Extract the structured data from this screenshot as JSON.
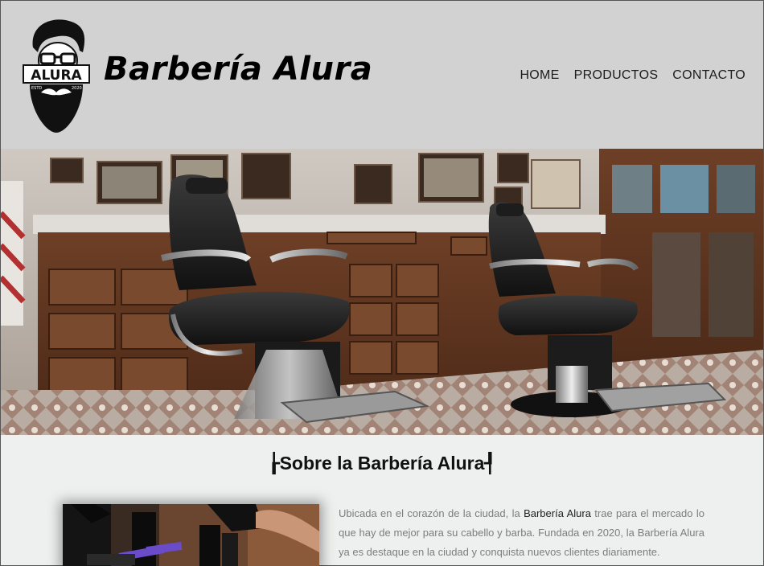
{
  "header": {
    "title": "Barbería Alura",
    "logo": {
      "name": "ALURA",
      "left_text": "ESTD",
      "right_text": "2020"
    },
    "nav": [
      "HOME",
      "PRODUCTOS",
      "CONTACTO"
    ],
    "background": "#d2d2d2"
  },
  "hero": {
    "icon": "barbershop-interior-photo"
  },
  "about": {
    "title": "Sobre la Barbería Alura",
    "image_icon": "barber-tools-photo",
    "text_before": "Ubicada en el corazón de la ciudad, la ",
    "text_strong": "Barbería Alura",
    "text_after": " trae para el mercado lo que hay de mejor para su cabello y barba. Fundada en 2020, la Barbería Alura ya es destaque en la ciudad y conquista nuevos clientes diariamente."
  }
}
